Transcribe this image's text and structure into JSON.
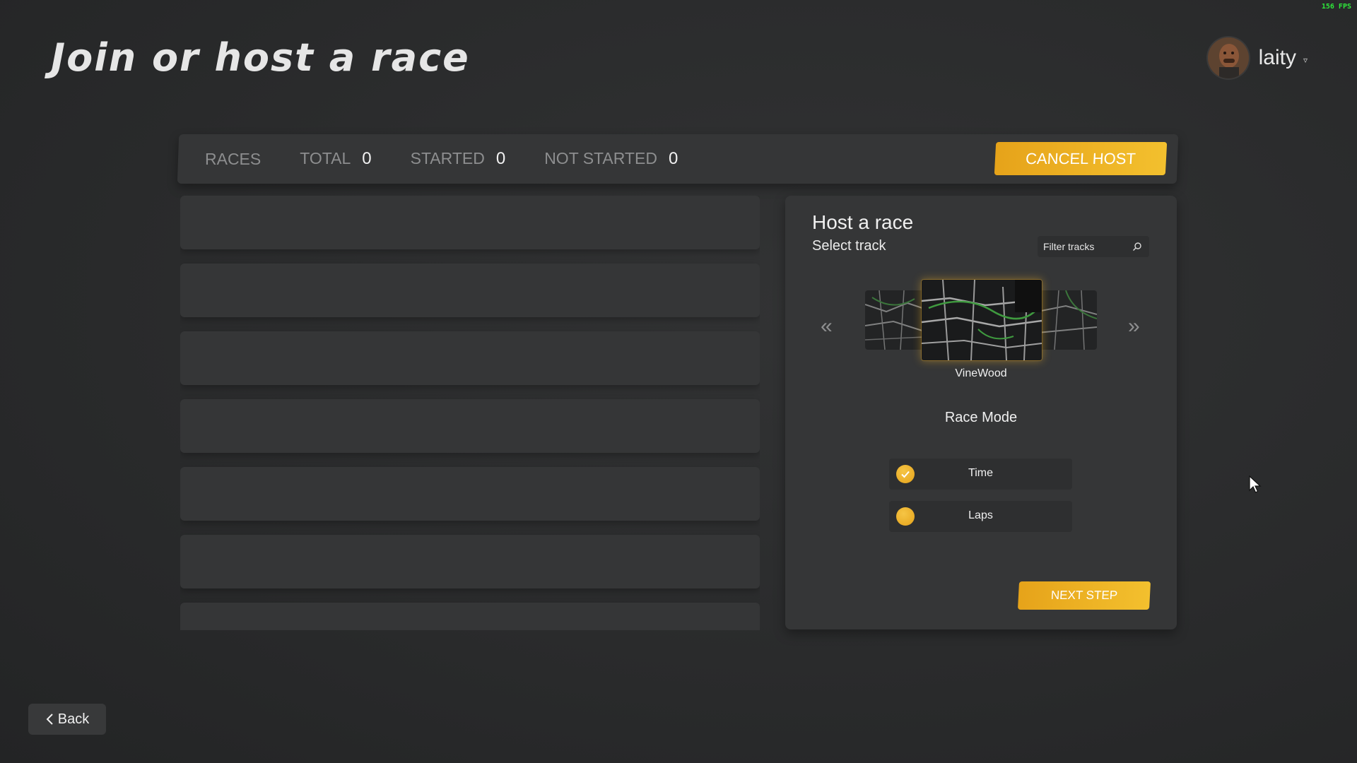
{
  "hud": {
    "fps": "156 FPS"
  },
  "header": {
    "title": "Join or host a race",
    "username": "laity",
    "avatar_icon": "player-portrait-icon",
    "dropdown_icon": "chevron-down-icon"
  },
  "stats": {
    "races_label": "RACES",
    "total_label": "TOTAL",
    "total_value": "0",
    "started_label": "STARTED",
    "started_value": "0",
    "not_started_label": "NOT STARTED",
    "not_started_value": "0",
    "cancel_host_label": "CANCEL HOST"
  },
  "race_list": {
    "slots": 7
  },
  "host": {
    "title": "Host a race",
    "subtitle": "Select track",
    "filter_placeholder": "Filter tracks",
    "selected_track": "VineWood",
    "race_mode_title": "Race Mode",
    "modes": [
      {
        "label": "Time",
        "selected": true
      },
      {
        "label": "Laps",
        "selected": false
      }
    ],
    "next_label": "NEXT STEP"
  },
  "footer": {
    "back_label": "Back"
  },
  "colors": {
    "accent": "#f0b427",
    "panel": "#353637",
    "background": "#2b2c2d",
    "fps_green": "#2ee83a"
  }
}
